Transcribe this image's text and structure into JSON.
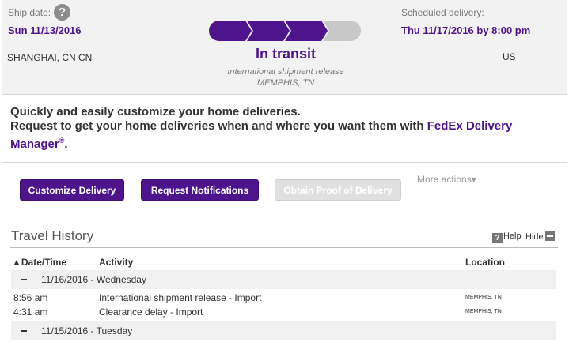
{
  "shipment": {
    "ship_date_label": "Ship date:",
    "ship_date": "Sun 11/13/2016",
    "origin": "SHANGHAI, CN CN",
    "status": "In transit",
    "status_detail": "International shipment release",
    "status_location": "MEMPHIS, TN",
    "scheduled_label": "Scheduled delivery:",
    "scheduled_date": "Thu 11/17/2016 by 8:00 pm",
    "destination_country": "US",
    "progress": {
      "completed_steps": 3,
      "total_steps": 4
    }
  },
  "promo": {
    "line1": "Quickly and easily customize your home deliveries.",
    "line2_prefix": "Request to get your home deliveries when and where you want them with ",
    "brand": "FedEx Delivery Manager",
    "reg": "®",
    "suffix": "."
  },
  "actions": {
    "customize": "Customize Delivery",
    "notifications": "Request Notifications",
    "proof": "Obtain Proof of Delivery",
    "more": "More actions▾"
  },
  "history": {
    "title": "Travel History",
    "help": "Help",
    "hide": "Hide",
    "columns": {
      "date": "▲Date/Time",
      "activity": "Activity",
      "location": "Location"
    },
    "groups": [
      {
        "date": "11/16/2016 - Wednesday",
        "events": [
          {
            "time": "8:56 am",
            "activity": "International shipment release - Import",
            "location": "MEMPHIS, TN"
          },
          {
            "time": "4:31 am",
            "activity": "Clearance delay - Import",
            "location": "MEMPHIS, TN"
          }
        ]
      },
      {
        "date": "11/15/2016 - Tuesday",
        "events": []
      }
    ]
  },
  "colors": {
    "brand_purple": "#4d148c",
    "progress_pending": "#c8c8c8",
    "header_bg": "#f2f2f2"
  }
}
